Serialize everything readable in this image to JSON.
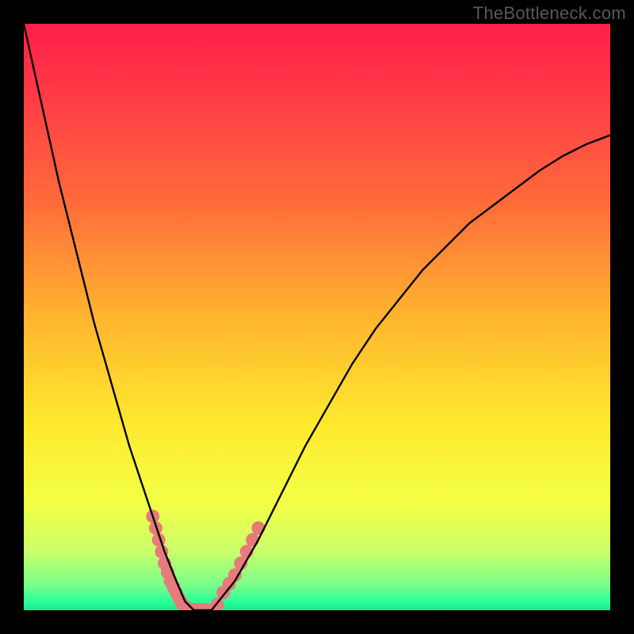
{
  "watermark": "TheBottleneck.com",
  "chart_data": {
    "type": "line",
    "title": "",
    "xlabel": "",
    "ylabel": "",
    "xlim": [
      0,
      100
    ],
    "ylim": [
      0,
      100
    ],
    "grid": false,
    "legend": false,
    "curve_x": [
      0,
      2,
      4,
      6,
      8,
      10,
      12,
      14,
      16,
      18,
      20,
      22,
      24,
      26,
      27.5,
      29,
      32,
      36,
      40,
      44,
      48,
      52,
      56,
      60,
      64,
      68,
      72,
      76,
      80,
      84,
      88,
      92,
      96,
      100
    ],
    "curve_y": [
      100,
      91,
      82,
      73,
      65,
      57,
      49,
      42,
      35,
      28,
      22,
      16,
      10,
      5,
      1.5,
      0,
      0,
      5,
      12,
      20,
      28,
      35,
      42,
      48,
      53,
      58,
      62,
      66,
      69,
      72,
      75,
      77.5,
      79.5,
      81
    ],
    "highlight_band": {
      "ymin": 0,
      "ymax": 30
    },
    "highlight_points_x": [
      22,
      22.5,
      23,
      23.5,
      24,
      24.5,
      25,
      25.5,
      26,
      26.5,
      27,
      27.5,
      28,
      29,
      30,
      31,
      32,
      33,
      34,
      35,
      36,
      37,
      38,
      39,
      40
    ],
    "highlight_points_y": [
      16,
      14,
      12,
      10,
      8,
      6.5,
      5,
      4,
      3,
      2,
      1.2,
      0.6,
      0.3,
      0,
      0,
      0,
      0,
      1,
      3,
      4.5,
      6,
      8,
      10,
      12,
      14
    ],
    "gradient_stops": [
      {
        "offset": 0.0,
        "color": "#ff1f4a"
      },
      {
        "offset": 0.12,
        "color": "#ff3a46"
      },
      {
        "offset": 0.3,
        "color": "#ff6a3a"
      },
      {
        "offset": 0.5,
        "color": "#ffb42f"
      },
      {
        "offset": 0.68,
        "color": "#ffe92e"
      },
      {
        "offset": 0.82,
        "color": "#f3ff45"
      },
      {
        "offset": 0.9,
        "color": "#c9ff6a"
      },
      {
        "offset": 0.955,
        "color": "#7dff88"
      },
      {
        "offset": 0.985,
        "color": "#2bff9a"
      },
      {
        "offset": 1.0,
        "color": "#18e98e"
      }
    ],
    "colors": {
      "curve": "#000000",
      "markers": "#e77a7a",
      "background_outer": "#000000"
    }
  }
}
